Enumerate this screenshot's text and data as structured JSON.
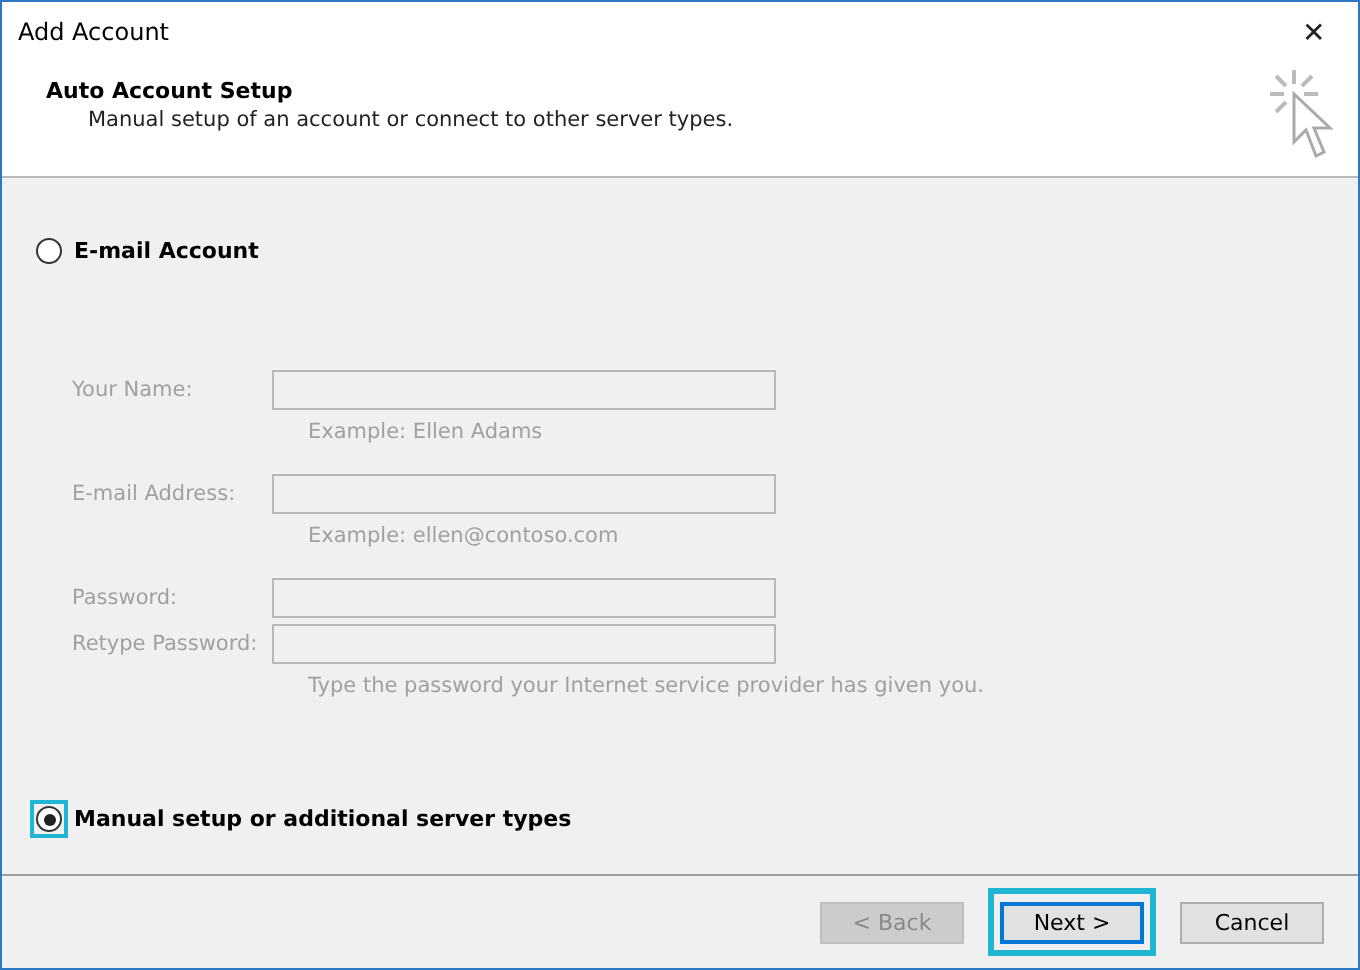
{
  "window": {
    "title": "Add Account",
    "close": "✕"
  },
  "header": {
    "title": "Auto Account Setup",
    "subtitle": "Manual setup of an account or connect to other server types."
  },
  "options": [
    {
      "label": "E-mail Account",
      "selected": false,
      "highlighted": false
    },
    {
      "label": "Manual setup or additional server types",
      "selected": true,
      "highlighted": true
    }
  ],
  "fields": [
    {
      "label": "Your Name:",
      "hint": "Example: Ellen Adams",
      "disabled": true
    },
    {
      "label": "E-mail Address:",
      "hint": "Example: ellen@contoso.com",
      "disabled": true
    },
    {
      "label": "Password:",
      "disabled": true
    },
    {
      "label": "Retype Password:",
      "hint": "Type the password your Internet service provider has given you.",
      "disabled": true
    }
  ],
  "buttons": [
    {
      "label": "< Back",
      "disabled": true,
      "highlighted": false
    },
    {
      "label": "Next >",
      "disabled": false,
      "highlighted": true
    },
    {
      "label": "Cancel",
      "disabled": false,
      "highlighted": false
    }
  ]
}
